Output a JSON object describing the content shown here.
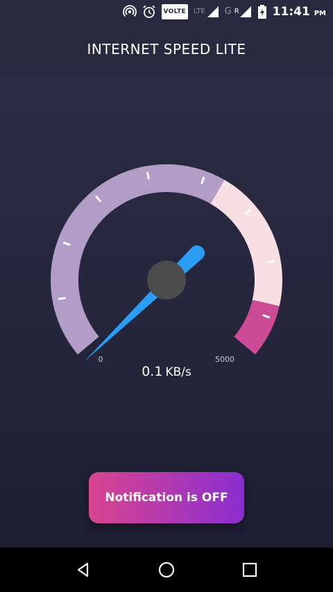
{
  "status_bar": {
    "volte_label": "VOLTE",
    "lte_label": "LTE",
    "g_label": "G",
    "r_label": "R",
    "time": "11:41",
    "ampm": "PM",
    "icons": [
      "hotspot-icon",
      "alarm-icon",
      "volte-icon",
      "signal-icon",
      "signal-icon",
      "battery-charging-icon"
    ]
  },
  "app_bar": {
    "title": "INTERNET SPEED LITE"
  },
  "gauge": {
    "min_label": "0",
    "max_label": "5000",
    "needle_fraction": 0.0,
    "colors": {
      "low_band": "#b19dc6",
      "mid_band": "#f8dfe4",
      "high_band": "#cc4b95",
      "needle": "#2a9df4",
      "hub": "#4c4c4c"
    }
  },
  "speed": {
    "value": "0.1",
    "unit": "KB/s"
  },
  "notification_button": {
    "label": "Notification is OFF",
    "gradient": [
      "#d9458f",
      "#8a2ed0"
    ]
  },
  "nav_bar": {
    "icons": [
      "back-icon",
      "home-icon",
      "recents-icon"
    ]
  }
}
